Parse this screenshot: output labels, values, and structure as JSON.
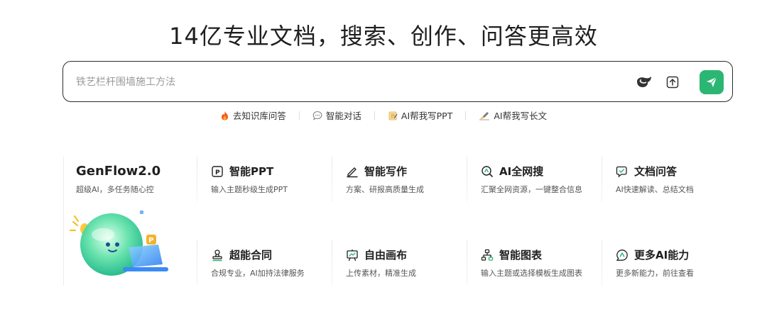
{
  "headline": "14亿专业文档，搜索、创作、问答更高效",
  "search": {
    "placeholder": "铁艺栏杆围墙施工方法"
  },
  "quick_links": [
    {
      "label": "去知识库问答",
      "icon": "fire-icon"
    },
    {
      "label": "智能对话",
      "icon": "chat-bubble-icon"
    },
    {
      "label": "AI帮我写PPT",
      "icon": "notepad-icon"
    },
    {
      "label": "AI帮我写长文",
      "icon": "pen-writing-icon"
    }
  ],
  "hero": {
    "title": "GenFlow2.0",
    "subtitle": "超级AI，多任务随心控"
  },
  "features": [
    {
      "title": "智能PPT",
      "desc": "输入主题秒级生成PPT",
      "icon": "ppt-icon"
    },
    {
      "title": "智能写作",
      "desc": "方案、研报高质量生成",
      "icon": "pen-icon"
    },
    {
      "title": "AI全网搜",
      "desc": "汇聚全网资源，一键整合信息",
      "icon": "search-web-icon"
    },
    {
      "title": "文档问答",
      "desc": "AI快速解读、总结文档",
      "icon": "doc-chat-icon"
    },
    {
      "title": "超能合同",
      "desc": "合规专业，AI加持法律服务",
      "icon": "stamp-icon"
    },
    {
      "title": "自由画布",
      "desc": "上传素材，精准生成",
      "icon": "canvas-icon"
    },
    {
      "title": "智能图表",
      "desc": "输入主题或选择模板生成图表",
      "icon": "diagram-icon"
    },
    {
      "title": "更多AI能力",
      "desc": "更多新能力，前往查看",
      "icon": "more-ai-icon"
    }
  ],
  "colors": {
    "accent": "#2bb673",
    "text": "#1f1f1f",
    "muted": "#555555",
    "border": "#2b2b2b"
  }
}
